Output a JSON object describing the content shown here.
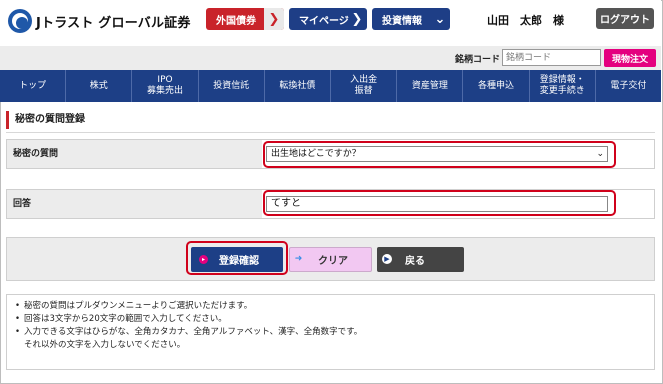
{
  "header": {
    "logo_text": "Jトラスト グローバル証券",
    "btn_foreign_bonds": "外国債券",
    "btn_mypage": "マイページ",
    "btn_investment_info": "投資情報",
    "user_name": "山田　太郎　様",
    "logout": "ログアウト",
    "chevron": "❯"
  },
  "search": {
    "label": "銘柄コード",
    "placeholder": "銘柄コード",
    "button": "現物注文"
  },
  "nav": {
    "items": [
      {
        "label": "トップ"
      },
      {
        "label": "株式"
      },
      {
        "label": "IPO\n募集売出"
      },
      {
        "label": "投資信託"
      },
      {
        "label": "転換社債"
      },
      {
        "label": "入出金\n振替"
      },
      {
        "label": "資産管理"
      },
      {
        "label": "各種申込"
      },
      {
        "label": "登録情報・\n変更手続き"
      },
      {
        "label": "電子交付"
      }
    ]
  },
  "page": {
    "section_title": "秘密の質問登録"
  },
  "form": {
    "question_label": "秘密の質問",
    "question_value": "出生地はどこですか？",
    "answer_label": "回答",
    "answer_value": "てすと"
  },
  "buttons": {
    "confirm": "登録確認",
    "clear": "クリア",
    "back": "戻る"
  },
  "notes": [
    "秘密の質問はプルダウンメニューよりご選択いただけます。",
    "回答は3文字から20文字の範囲で入力してください。",
    "入力できる文字はひらがな、全角カタカナ、全角アルファベット、漢字、全角数字です。",
    "それ以外の文字を入力しないでください。"
  ],
  "colors": {
    "brand_navy": "#1d3f86",
    "brand_red": "#c9232a",
    "accent_pink": "#e4007f",
    "highlight_red": "#d0011b"
  }
}
